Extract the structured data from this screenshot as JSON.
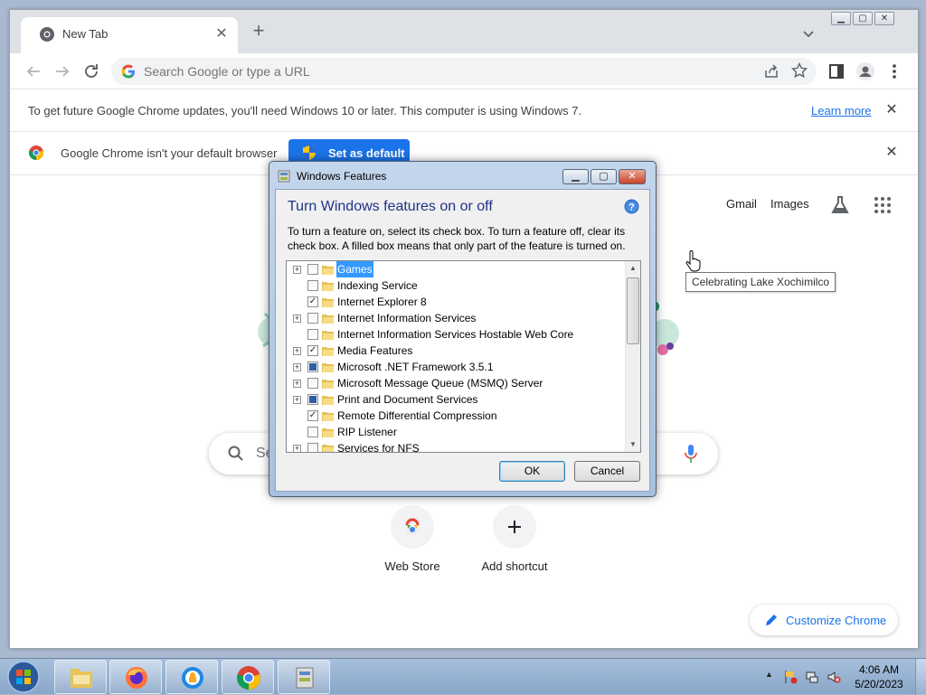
{
  "browser": {
    "tab_title": "New Tab",
    "omnibox_placeholder": "Search Google or type a URL",
    "update_bar": {
      "message": "To get future Google Chrome updates, you'll need Windows 10 or later. This computer is using Windows 7.",
      "link": "Learn more"
    },
    "default_bar": {
      "message": "Google Chrome isn't your default browser",
      "button": "Set as default"
    }
  },
  "ntp": {
    "links": [
      "Gmail",
      "Images"
    ],
    "tooltip": "Celebrating Lake Xochimilco",
    "search_placeholder": "Se",
    "shortcuts": [
      {
        "label": "Web Store",
        "icon": "webstore-icon"
      },
      {
        "label": "Add shortcut",
        "icon": "plus-icon"
      }
    ],
    "customize_label": "Customize Chrome"
  },
  "dialog": {
    "title": "Windows Features",
    "heading": "Turn Windows features on or off",
    "description": "To turn a feature on, select its check box. To turn a feature off, clear its check box. A filled box means that only part of the feature is turned on.",
    "features": [
      {
        "name": "Games",
        "state": "unchecked",
        "expandable": true,
        "selected": true
      },
      {
        "name": "Indexing Service",
        "state": "unchecked",
        "expandable": false
      },
      {
        "name": "Internet Explorer 8",
        "state": "checked",
        "expandable": false
      },
      {
        "name": "Internet Information Services",
        "state": "unchecked",
        "expandable": true
      },
      {
        "name": "Internet Information Services Hostable Web Core",
        "state": "unchecked",
        "expandable": false
      },
      {
        "name": "Media Features",
        "state": "checked",
        "expandable": true
      },
      {
        "name": "Microsoft .NET Framework 3.5.1",
        "state": "partial",
        "expandable": true
      },
      {
        "name": "Microsoft Message Queue (MSMQ) Server",
        "state": "unchecked",
        "expandable": true
      },
      {
        "name": "Print and Document Services",
        "state": "partial",
        "expandable": true
      },
      {
        "name": "Remote Differential Compression",
        "state": "checked",
        "expandable": false
      },
      {
        "name": "RIP Listener",
        "state": "unchecked",
        "expandable": false
      },
      {
        "name": "Services for NFS",
        "state": "unchecked",
        "expandable": true
      }
    ],
    "ok_label": "OK",
    "cancel_label": "Cancel"
  },
  "taskbar": {
    "apps": [
      "explorer-icon",
      "firefox-icon",
      "vpn-icon",
      "chrome-icon",
      "windows-features-icon"
    ],
    "time": "4:06 AM",
    "date": "5/20/2023"
  },
  "colors": {
    "accent": "#1a73e8",
    "dialog_heading": "#1e3287"
  }
}
